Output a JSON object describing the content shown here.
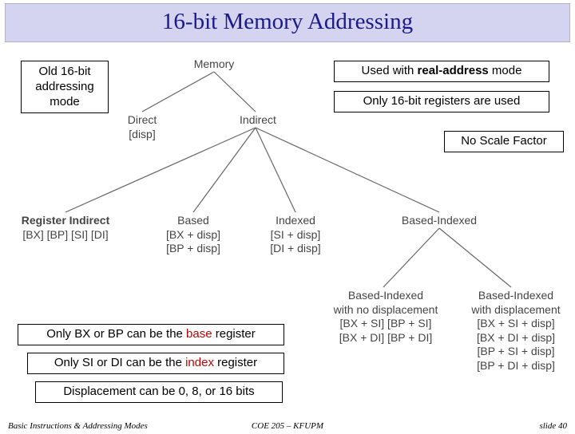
{
  "title": "16-bit Memory Addressing",
  "callouts": {
    "old": {
      "line1": "Old 16-bit",
      "line2": "addressing",
      "line3": "mode"
    },
    "real_pre": "Used with ",
    "real_bold": "real-address",
    "real_post": " mode",
    "only16": "Only 16-bit registers are used",
    "noscale": "No Scale Factor",
    "base_pre": "Only BX or BP can be the ",
    "base_hl": "base",
    "base_post": " register",
    "index_pre": "Only SI or DI can be the ",
    "index_hl": "index",
    "index_post": " register",
    "disp": "Displacement can be 0, 8, or 16 bits"
  },
  "tree": {
    "root": "Memory",
    "l1": {
      "direct": "Direct",
      "direct_sub": "[disp]",
      "indirect": "Indirect"
    },
    "l2": {
      "regind": {
        "label": "Register Indirect",
        "sub": "[BX]  [BP]  [SI]  [DI]"
      },
      "based": {
        "label": "Based",
        "sub1": "[BX + disp]",
        "sub2": "[BP + disp]"
      },
      "indexed": {
        "label": "Indexed",
        "sub1": "[SI + disp]",
        "sub2": "[DI + disp]"
      },
      "bi": {
        "label": "Based-Indexed"
      }
    },
    "l3": {
      "nodisp": {
        "label1": "Based-Indexed",
        "label2": "with no displacement",
        "s1": "[BX + SI]  [BP + SI]",
        "s2": "[BX + DI]  [BP + DI]"
      },
      "wdisp": {
        "label1": "Based-Indexed",
        "label2": "with displacement",
        "s1": "[BX + SI + disp]",
        "s2": "[BX + DI + disp]",
        "s3": "[BP + SI + disp]",
        "s4": "[BP + DI + disp]"
      }
    }
  },
  "footer": {
    "left": "Basic Instructions & Addressing Modes",
    "mid": "COE 205 – KFUPM",
    "right": "slide 40"
  },
  "chart_data": {
    "type": "tree",
    "title": "16-bit Memory Addressing",
    "nodes": [
      {
        "id": "memory",
        "label": "Memory",
        "parent": null
      },
      {
        "id": "direct",
        "label": "Direct",
        "sub": "[disp]",
        "parent": "memory"
      },
      {
        "id": "indirect",
        "label": "Indirect",
        "parent": "memory"
      },
      {
        "id": "regind",
        "label": "Register Indirect",
        "sub": "[BX] [BP] [SI] [DI]",
        "parent": "indirect"
      },
      {
        "id": "based",
        "label": "Based",
        "sub": "[BX + disp], [BP + disp]",
        "parent": "indirect"
      },
      {
        "id": "indexed",
        "label": "Indexed",
        "sub": "[SI + disp], [DI + disp]",
        "parent": "indirect"
      },
      {
        "id": "basedindexed",
        "label": "Based-Indexed",
        "parent": "indirect"
      },
      {
        "id": "bi_nodisp",
        "label": "Based-Indexed with no displacement",
        "sub": "[BX+SI] [BP+SI] [BX+DI] [BP+DI]",
        "parent": "basedindexed"
      },
      {
        "id": "bi_disp",
        "label": "Based-Indexed with displacement",
        "sub": "[BX+SI+disp] [BX+DI+disp] [BP+SI+disp] [BP+DI+disp]",
        "parent": "basedindexed"
      }
    ],
    "annotations": [
      "Old 16-bit addressing mode",
      "Used with real-address mode",
      "Only 16-bit registers are used",
      "No Scale Factor",
      "Only BX or BP can be the base register",
      "Only SI or DI can be the index register",
      "Displacement can be 0, 8, or 16 bits"
    ]
  }
}
